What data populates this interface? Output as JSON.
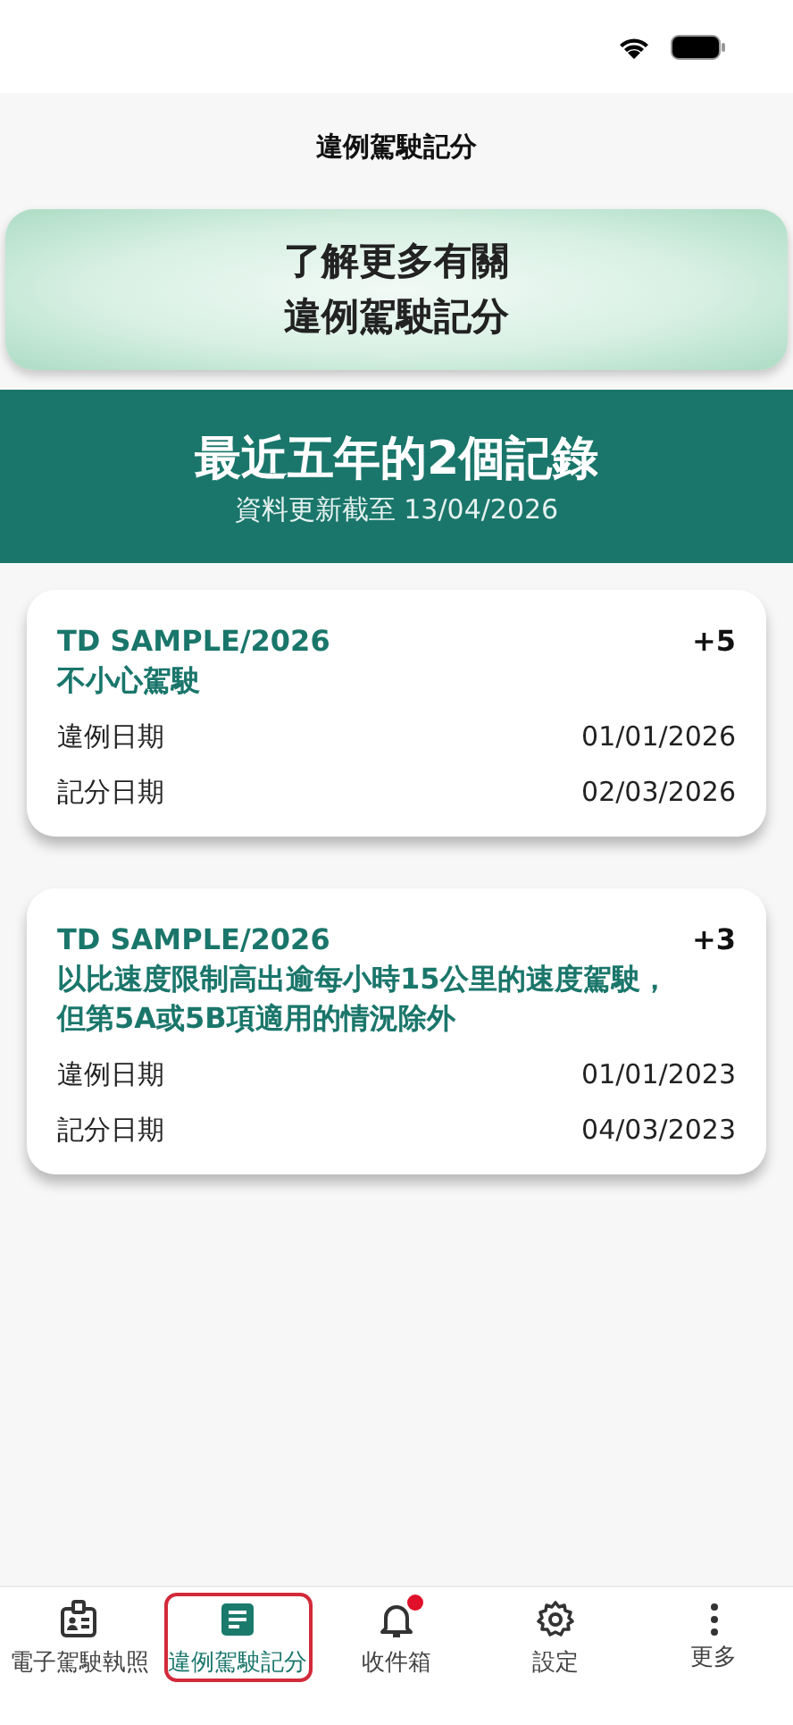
{
  "header": {
    "title": "違例駕駛記分"
  },
  "info_button": {
    "lines": [
      "了解更多有關",
      "違例駕駛記分"
    ]
  },
  "summary": {
    "title": "最近五年的2個記錄",
    "updated": "資料更新截至 13/04/2026"
  },
  "records": [
    {
      "reference": "TD SAMPLE/2026",
      "points": "+5",
      "offence": "不小心駕駛",
      "fields": [
        {
          "label": "違例日期",
          "value": "01/01/2026"
        },
        {
          "label": "記分日期",
          "value": "02/03/2026"
        }
      ]
    },
    {
      "reference": "TD SAMPLE/2026",
      "points": "+3",
      "offence": "以比速度限制高出逾每小時15公里的速度駕駛，但第5A或5B項適用的情況除外",
      "fields": [
        {
          "label": "違例日期",
          "value": "01/01/2023"
        },
        {
          "label": "記分日期",
          "value": "04/03/2023"
        }
      ]
    }
  ],
  "tab_bar": [
    {
      "kind": "license",
      "label": "電子駕駛執照",
      "selected": false,
      "badge": false
    },
    {
      "kind": "record",
      "label": "違例駕駛記分",
      "selected": true,
      "badge": false
    },
    {
      "kind": "inbox",
      "label": "收件箱",
      "selected": false,
      "badge": true
    },
    {
      "kind": "settings",
      "label": "設定",
      "selected": false,
      "badge": false
    },
    {
      "kind": "more",
      "label": "更多",
      "selected": false,
      "badge": false
    }
  ]
}
